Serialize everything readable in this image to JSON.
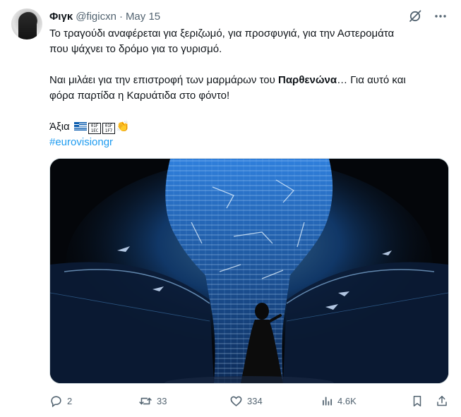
{
  "tweet": {
    "author_name": "Φιγκ",
    "author_handle": "@figicxn",
    "separator": "·",
    "date": "May 15",
    "text_line1": "Το τραγούδι αναφέρεται για ξεριζωμό, για προσφυγιά, για την Αστερομάτα",
    "text_line2": "που ψάχνει το δρόμο για το γυρισμό.",
    "text_p2_before": "Ναι μιλάει για την επιστροφή των μαρμάρων του ",
    "text_p2_bold": "Παρθενώνα",
    "text_p2_after": "… Για αυτό και",
    "text_p2_line2": "φόρα παρτίδα η Καρυάτιδα στο φόντο!",
    "text_p3": "Άξια",
    "tofu1": "01F 1EC",
    "tofu2": "01F 1F7",
    "hashtag": "#eurovisiongr",
    "media_icon": "video-still-stage-projection"
  },
  "actions": {
    "replies": "2",
    "retweets": "33",
    "likes": "334",
    "views": "4.6K"
  },
  "icons": {
    "grok": "grok-icon",
    "more": "more-icon",
    "reply": "reply-icon",
    "retweet": "retweet-icon",
    "like": "heart-icon",
    "views": "views-icon",
    "bookmark": "bookmark-icon",
    "share": "share-icon"
  },
  "colors": {
    "accent": "#1d9bf0",
    "muted": "#536471",
    "text": "#0f1419"
  }
}
